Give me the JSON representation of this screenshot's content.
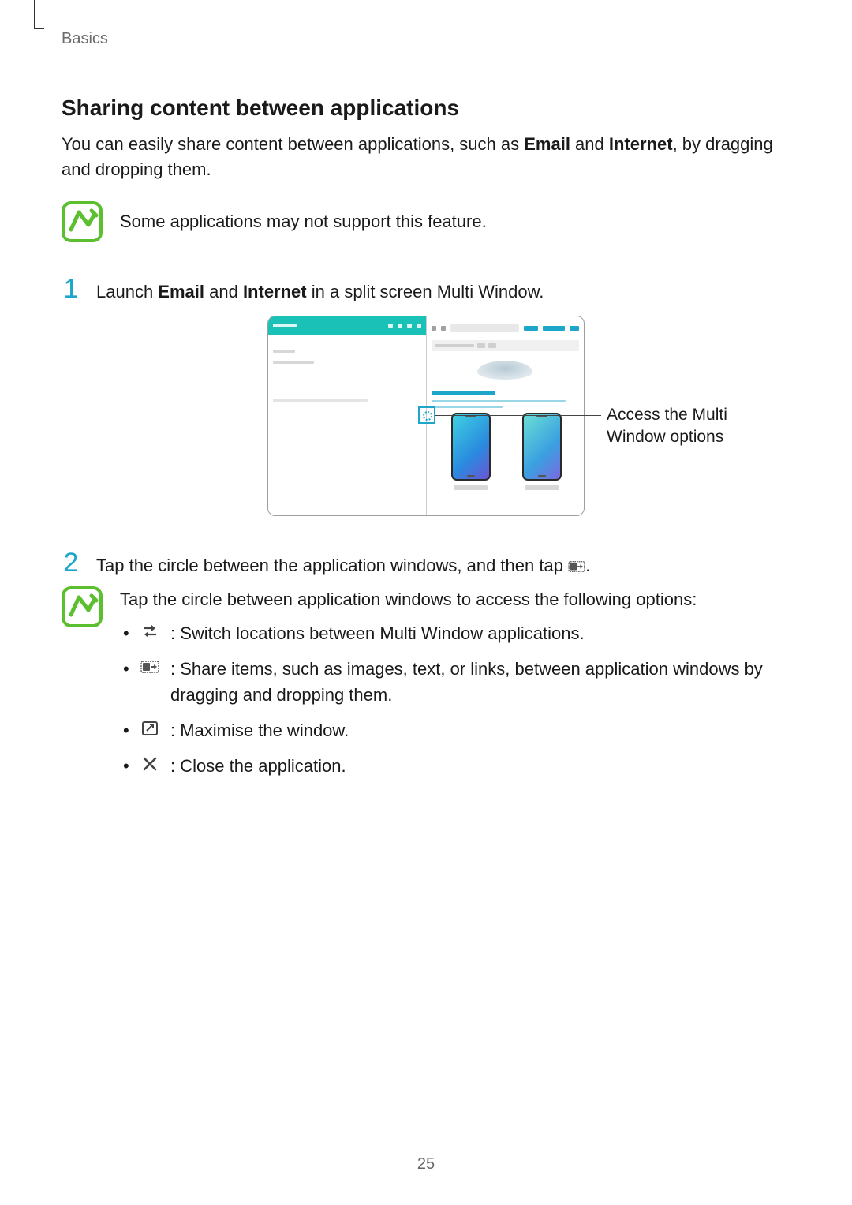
{
  "breadcrumb": "Basics",
  "section_title": "Sharing content between applications",
  "intro_pre": "You can easily share content between applications, such as ",
  "intro_app1": "Email",
  "intro_mid": " and ",
  "intro_app2": "Internet",
  "intro_post": ", by dragging and dropping them.",
  "note_unsupported": "Some applications may not support this feature.",
  "steps": {
    "s1_num": "1",
    "s1_pre": "Launch ",
    "s1_app1": "Email",
    "s1_mid": " and ",
    "s1_app2": "Internet",
    "s1_post": " in a split screen Multi Window.",
    "s2_num": "2",
    "s2_pre": "Tap the circle between the application windows, and then tap ",
    "s2_post": "."
  },
  "figure": {
    "callout_line1": "Access the Multi",
    "callout_line2": "Window options"
  },
  "note_options_intro": "Tap the circle between application windows to access the following options:",
  "options": {
    "switch": " : Switch locations between Multi Window applications.",
    "share": " : Share items, such as images, text, or links, between application windows by dragging and dropping them.",
    "maximise": " : Maximise the window.",
    "close": " : Close the application."
  },
  "page_number": "25"
}
